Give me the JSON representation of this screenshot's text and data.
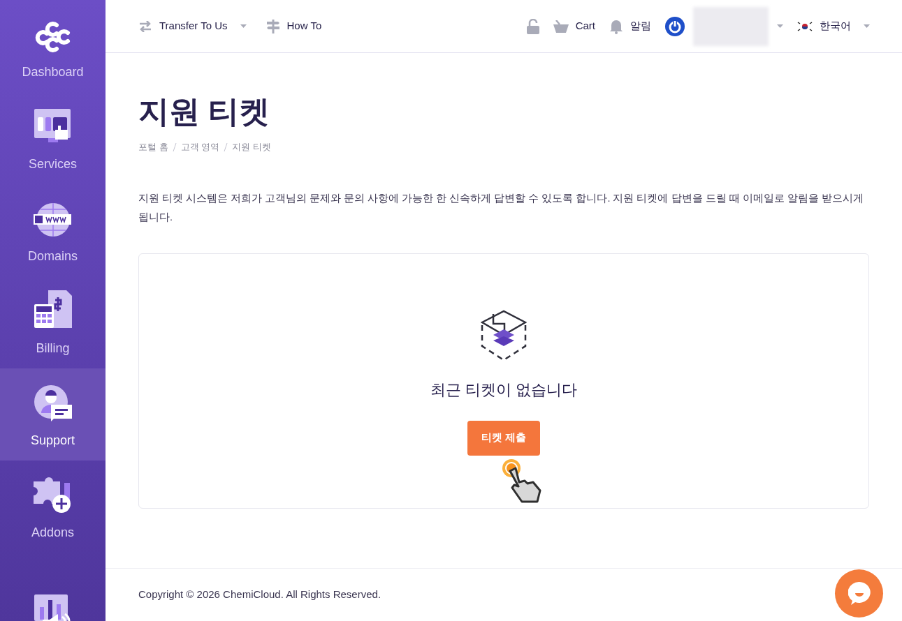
{
  "sidebar": {
    "items": [
      {
        "kind": "logo",
        "label": "Dashboard",
        "selected": false
      },
      {
        "kind": "services",
        "label": "Services",
        "selected": false
      },
      {
        "kind": "domains",
        "label": "Domains",
        "selected": false
      },
      {
        "kind": "billing",
        "label": "Billing",
        "selected": false
      },
      {
        "kind": "support",
        "label": "Support",
        "selected": true
      },
      {
        "kind": "addons",
        "label": "Addons",
        "selected": false
      },
      {
        "kind": "affiliates",
        "selected": false
      }
    ]
  },
  "topbar": {
    "left": [
      {
        "kind": "transfer",
        "label": "Transfer To Us",
        "dropdown": true
      },
      {
        "kind": "signpost",
        "label": "How To",
        "dropdown": false
      }
    ],
    "right": [
      {
        "kind": "lock"
      },
      {
        "kind": "cart",
        "label": "Cart"
      },
      {
        "kind": "bell",
        "label": "알림"
      },
      {
        "kind": "account",
        "dropdown": true
      },
      {
        "kind": "flag",
        "label": "한국어",
        "dropdown": true
      }
    ]
  },
  "page": {
    "title": "지원 티켓",
    "breadcrumb": [
      "포털 홈",
      "고객 영역",
      "지원 티켓"
    ],
    "intro": "지원 티켓 시스템은 저희가 고객님의 문제와 문의 사항에 가능한 한 신속하게 답변할 수 있도록 합니다. 지원 티켓에 답변을 드릴 때 이메일로 알림을 받으시게 됩니다.",
    "empty_state": {
      "message": "최근 티켓이 없습니다",
      "button": "티켓 제출"
    }
  },
  "footer": {
    "copyright": "Copyright © 2026 ChemiCloud. All Rights Reserved."
  }
}
